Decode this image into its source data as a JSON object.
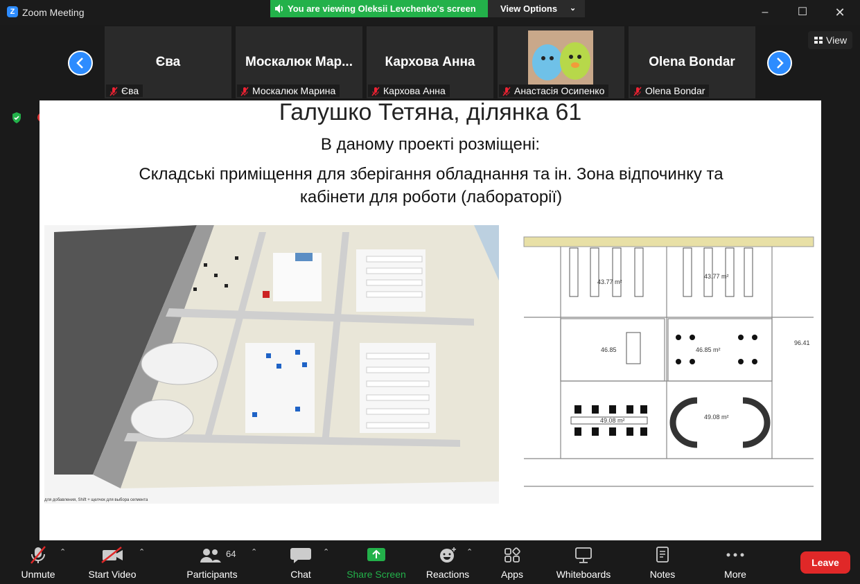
{
  "window": {
    "app_title": "Zoom Meeting"
  },
  "banner": {
    "text": "You are viewing Oleksii Levchenko's screen",
    "view_options": "View Options"
  },
  "view_button": {
    "label": "View"
  },
  "participants_strip": [
    {
      "display": "Єва",
      "name": "Єва"
    },
    {
      "display": "Москалюк  Мар...",
      "name": "Москалюк Марина"
    },
    {
      "display": "Кархова Анна",
      "name": "Кархова Анна"
    },
    {
      "display": "",
      "name": "Анастасія Осипенко"
    },
    {
      "display": "Olena Bondar",
      "name": "Olena Bondar"
    }
  ],
  "slide": {
    "title": "Галушко Тетяна, ділянка 61",
    "subtitle": "В даному проекті розміщені:",
    "body": "Складські приміщення для зберігання обладнання та ін. Зона відпочинку та кабінети для роботи (лабораторії)",
    "render_caption": "для добавления, Shift + щелчок для выбора сегмента",
    "plan_labels": [
      "43.77 m²",
      "43.77 m²",
      "46.85",
      "46.85 m²",
      "49.08 m²",
      "49.08 m²",
      "96.41"
    ]
  },
  "toolbar": {
    "unmute": "Unmute",
    "start_video": "Start Video",
    "participants": "Participants",
    "participants_count": "64",
    "chat": "Chat",
    "share_screen": "Share Screen",
    "reactions": "Reactions",
    "apps": "Apps",
    "whiteboards": "Whiteboards",
    "notes": "Notes",
    "more": "More",
    "leave": "Leave"
  },
  "colors": {
    "accent": "#2d8cff",
    "banner": "#23b14a",
    "leave": "#e02828",
    "share_green": "#23b14a"
  }
}
